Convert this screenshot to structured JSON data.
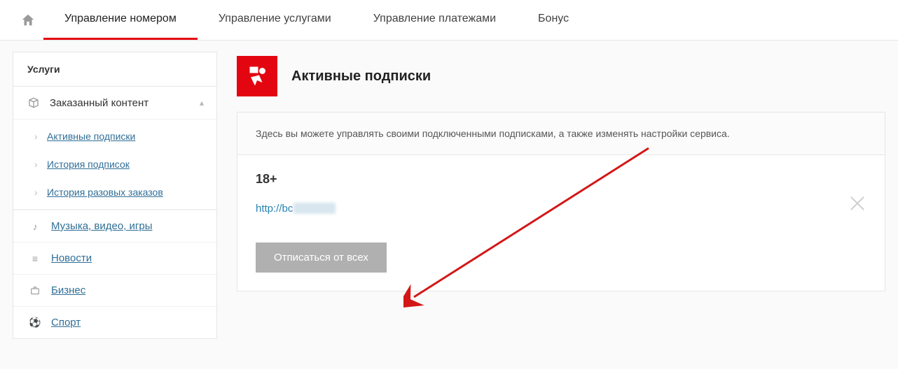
{
  "nav": {
    "tabs": [
      {
        "label": "Управление номером"
      },
      {
        "label": "Управление услугами"
      },
      {
        "label": "Управление платежами"
      },
      {
        "label": "Бонус"
      }
    ]
  },
  "sidebar": {
    "title": "Услуги",
    "group": {
      "label": "Заказанный контент",
      "items": [
        "Активные подписки",
        "История подписок",
        "История разовых заказов"
      ]
    },
    "cats": [
      "Музыка, видео, игры",
      "Новости",
      "Бизнес",
      "Спорт"
    ]
  },
  "main": {
    "title": "Активные подписки",
    "info": "Здесь вы можете управлять своими подключенными подписками, а также изменять настройки сервиса.",
    "age_label": "18+",
    "url_prefix": "http://bc",
    "unsubscribe_label": "Отписаться от всех"
  }
}
